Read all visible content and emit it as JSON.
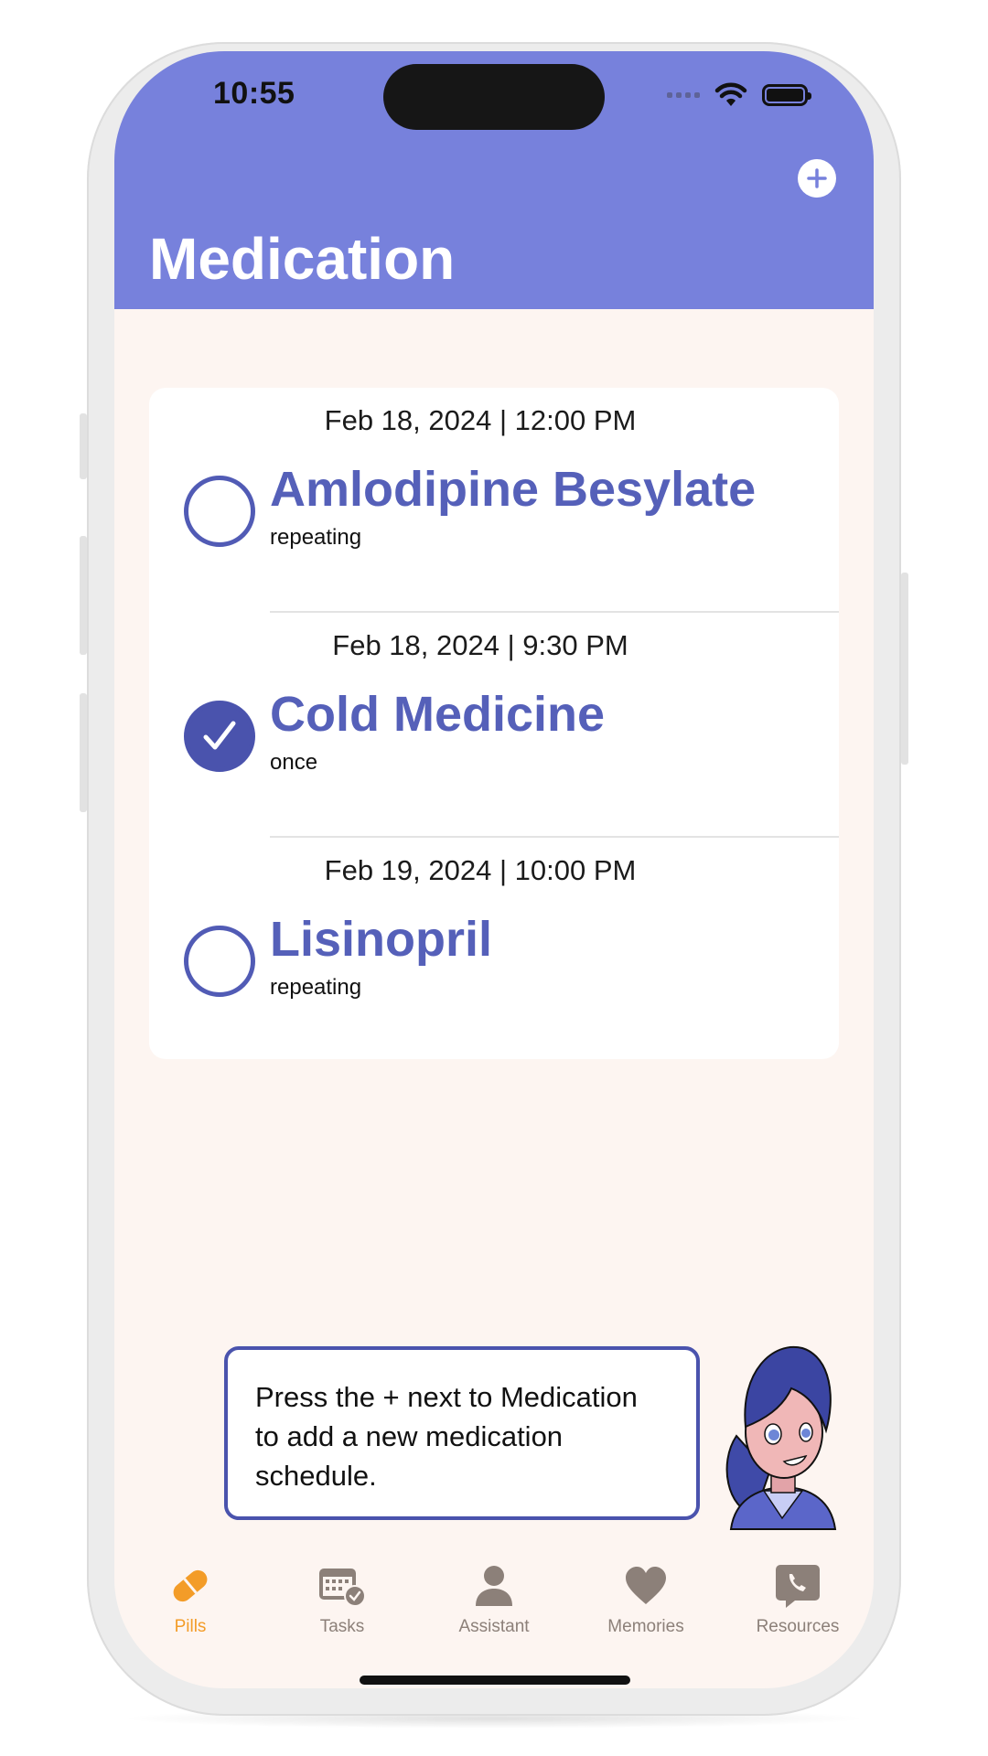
{
  "status_bar": {
    "time": "10:55"
  },
  "header": {
    "title": "Medication",
    "add_button_icon": "plus-icon"
  },
  "medications": [
    {
      "datetime": "Feb 18, 2024 | 12:00 PM",
      "name": "Amlodipine Besylate",
      "frequency": "repeating",
      "taken": false
    },
    {
      "datetime": "Feb 18, 2024 | 9:30 PM",
      "name": "Cold Medicine",
      "frequency": "once",
      "taken": true
    },
    {
      "datetime": "Feb 19, 2024 | 10:00 PM",
      "name": "Lisinopril",
      "frequency": "repeating",
      "taken": false
    }
  ],
  "assistant": {
    "message": "Press the + next to Medication to add a new medication schedule."
  },
  "tabs": [
    {
      "label": "Pills",
      "icon": "pill-icon",
      "active": true
    },
    {
      "label": "Tasks",
      "icon": "calendar-check-icon",
      "active": false
    },
    {
      "label": "Assistant",
      "icon": "person-icon",
      "active": false
    },
    {
      "label": "Memories",
      "icon": "heart-icon",
      "active": false
    },
    {
      "label": "Resources",
      "icon": "phone-bubble-icon",
      "active": false
    }
  ],
  "colors": {
    "header": "#7781dc",
    "accent": "#4a53ad",
    "background": "#fdf5f1",
    "tab_active": "#f39c28",
    "tab_inactive": "#8c8079"
  }
}
